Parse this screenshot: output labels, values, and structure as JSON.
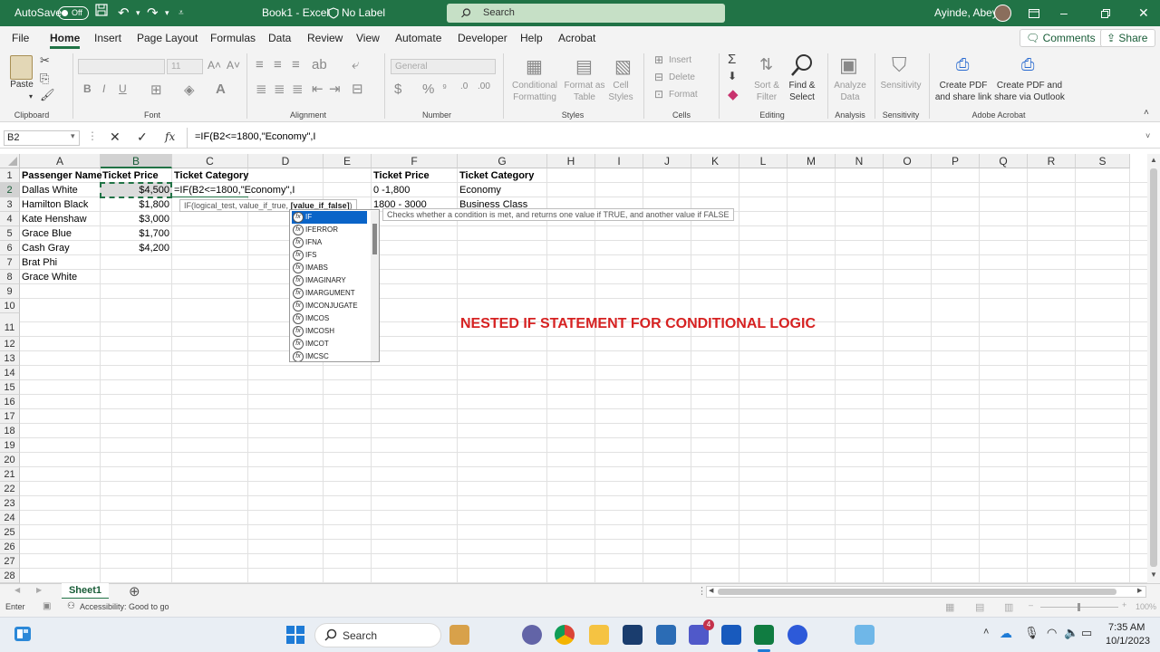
{
  "titlebar": {
    "autosave_label": "AutoSave",
    "autosave_state": "Off",
    "doc_title": "Book1 - Excel",
    "label_status": "No Label",
    "search_placeholder": "Search",
    "user_name": "Ayinde, Abey"
  },
  "menu": {
    "tabs": [
      "File",
      "Home",
      "Insert",
      "Page Layout",
      "Formulas",
      "Data",
      "Review",
      "View",
      "Automate",
      "Developer",
      "Help",
      "Acrobat"
    ],
    "active_tab": "Home",
    "comments_label": "Comments",
    "share_label": "Share"
  },
  "ribbon": {
    "groups": [
      "Clipboard",
      "Font",
      "Alignment",
      "Number",
      "Styles",
      "Cells",
      "Editing",
      "Analysis",
      "Sensitivity",
      "Adobe Acrobat"
    ],
    "paste_label": "Paste",
    "number_format": "General",
    "font_size": "11",
    "conditional_formatting": "Conditional Formatting",
    "format_as_table": "Format as Table",
    "cell_styles": "Cell Styles",
    "insert": "Insert",
    "delete": "Delete",
    "format": "Format",
    "sort_filter": "Sort & Filter",
    "find_select": "Find & Select",
    "analyze_data": "Analyze Data",
    "sensitivity": "Sensitivity",
    "create_pdf_link": "Create PDF and share link",
    "create_pdf_outlook": "Create PDF and share via Outlook"
  },
  "formula_bar": {
    "name_box": "B2",
    "fx_label": "fx",
    "formula": "=IF(B2<=1800,\"Economy\",I"
  },
  "columns": [
    "A",
    "B",
    "C",
    "D",
    "E",
    "F",
    "G",
    "H",
    "I",
    "J",
    "K",
    "L",
    "M",
    "N",
    "O",
    "P",
    "Q",
    "R",
    "S"
  ],
  "rows": [
    "1",
    "2",
    "3",
    "4",
    "5",
    "6",
    "7",
    "8",
    "9",
    "10",
    "11",
    "12",
    "13",
    "14",
    "15",
    "16",
    "17",
    "18",
    "19",
    "20",
    "21",
    "22",
    "23",
    "24",
    "25",
    "26",
    "27",
    "28"
  ],
  "sheet": {
    "headers": {
      "a1": "Passenger Name",
      "b1": "Ticket Price",
      "c1": "Ticket Category",
      "f1": "Ticket Price",
      "g1": "Ticket Category"
    },
    "passengers": [
      "Dallas White",
      "Hamilton Black",
      "Kate Henshaw",
      "Grace Blue",
      "Cash Gray",
      "Brat Phi",
      "Grace White"
    ],
    "prices": [
      "$4,500",
      "$1,800",
      "$3,000",
      "$1,700",
      "$4,200"
    ],
    "editing_cell": "=IF(B2<=1800,\"Economy\",I",
    "f2": "0 -1,800",
    "g2": "Economy",
    "f3": "1800 - 3000",
    "g3": "Business Class",
    "banner": "NESTED IF STATEMENT FOR CONDITIONAL LOGIC"
  },
  "autocomplete": {
    "hint_args": "IF(logical_test, value_if_true, ",
    "hint_bold": "[value_if_false]",
    "hint_close": ")",
    "description": "Checks whether a condition is met, and returns one value if TRUE, and another value if FALSE",
    "items": [
      "IF",
      "IFERROR",
      "IFNA",
      "IFS",
      "IMABS",
      "IMAGINARY",
      "IMARGUMENT",
      "IMCONJUGATE",
      "IMCOS",
      "IMCOSH",
      "IMCOT",
      "IMCSC"
    ]
  },
  "sheet_tabs": {
    "active": "Sheet1"
  },
  "status": {
    "mode": "Enter",
    "accessibility": "Accessibility: Good to go",
    "zoom": "100%"
  },
  "taskbar": {
    "search_placeholder": "Search",
    "time": "7:35 AM",
    "date": "10/1/2023"
  }
}
